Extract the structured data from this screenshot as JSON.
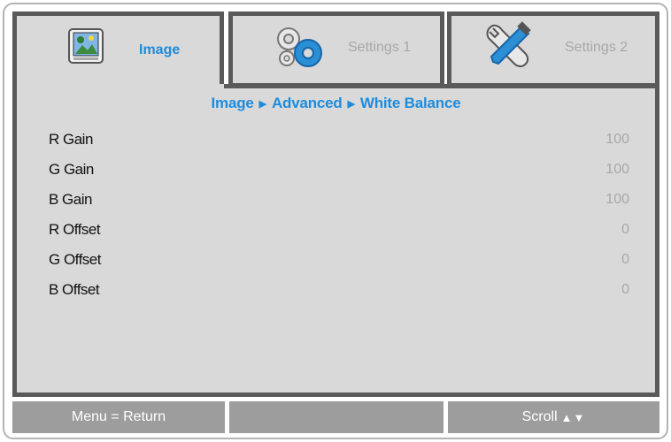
{
  "tabs": [
    {
      "label": "Image",
      "icon": "image-icon",
      "active": true
    },
    {
      "label": "Settings 1",
      "icon": "gears-icon",
      "active": false
    },
    {
      "label": "Settings 2",
      "icon": "tools-icon",
      "active": false
    }
  ],
  "breadcrumb": [
    "Image",
    "Advanced",
    "White Balance"
  ],
  "rows": [
    {
      "label": "R Gain",
      "value": "100"
    },
    {
      "label": "G Gain",
      "value": "100"
    },
    {
      "label": "B Gain",
      "value": "100"
    },
    {
      "label": "R Offset",
      "value": "0"
    },
    {
      "label": "G Offset",
      "value": "0"
    },
    {
      "label": "B Offset",
      "value": "0"
    }
  ],
  "footer": {
    "left": "Menu = Return",
    "middle": "",
    "right": "Scroll",
    "right_symbol": "▲▼"
  },
  "colors": {
    "accent": "#1e8cdc",
    "panel": "#d9d9d9",
    "border": "#5a5a5a",
    "footer": "#9d9d9d",
    "inactive_text": "#a8a8a8"
  }
}
